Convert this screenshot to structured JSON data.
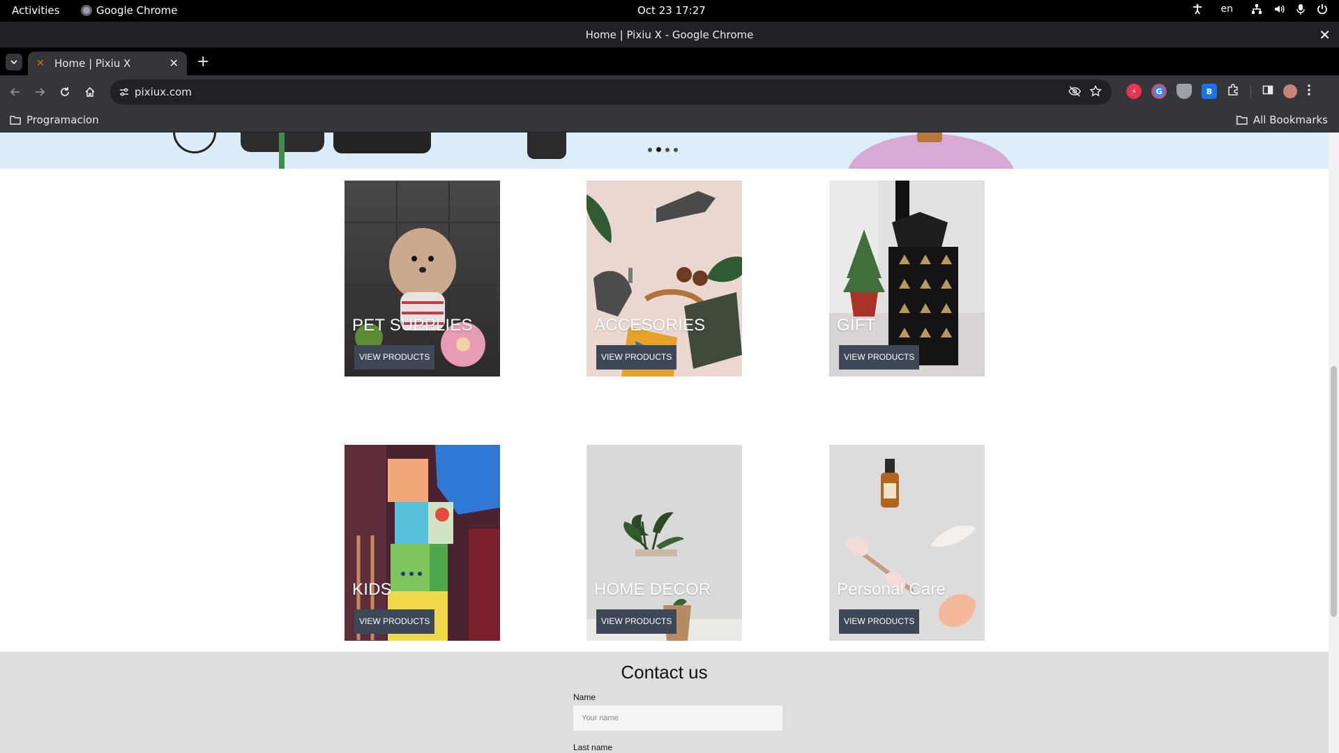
{
  "system_bar": {
    "activities": "Activities",
    "app_name": "Google Chrome",
    "datetime": "Oct 23  17:27",
    "language": "en"
  },
  "window": {
    "title": "Home | Pixiu X - Google Chrome"
  },
  "tabs": [
    {
      "title": "Home | Pixiu X"
    }
  ],
  "toolbar": {
    "url": "pixiux.com"
  },
  "bookmarks": {
    "folder": "Programacion",
    "all_bookmarks": "All Bookmarks"
  },
  "carousel": {
    "slide_count": 4,
    "active_index": 1
  },
  "categories": [
    {
      "title": "PET SUPPLIES",
      "button": "VIEW PRODUCTS"
    },
    {
      "title": "ACCESORIES",
      "button": "VIEW PRODUCTS"
    },
    {
      "title": "GIFT",
      "button": "VIEW PRODUCTS"
    },
    {
      "title": "KIDS",
      "button": "VIEW PRODUCTS"
    },
    {
      "title": "HOME DECOR",
      "button": "VIEW PRODUCTS"
    },
    {
      "title": "Personal Care",
      "button": "VIEW PRODUCTS"
    }
  ],
  "contact": {
    "heading": "Contact us",
    "name_label": "Name",
    "name_placeholder": "Your name",
    "lastname_label": "Last name"
  }
}
